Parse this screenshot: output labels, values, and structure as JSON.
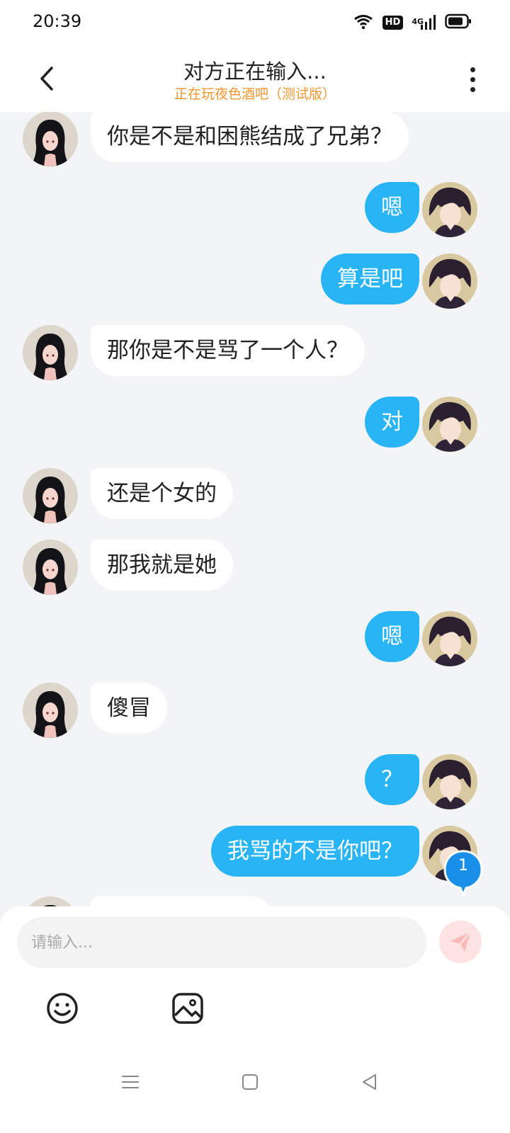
{
  "status_bar": {
    "time": "20:39",
    "hd_badge": "HD",
    "network": "4G",
    "icons": [
      "wifi-icon",
      "signal-icon",
      "battery-icon"
    ]
  },
  "header": {
    "title": "对方正在输入...",
    "subtitle": "正在玩夜色酒吧（测试版）",
    "back_icon": "chevron-left-icon",
    "more_icon": "more-vertical-icon"
  },
  "messages": [
    {
      "side": "left",
      "text": "你是不是和困熊结成了兄弟？"
    },
    {
      "side": "right",
      "text": "嗯"
    },
    {
      "side": "right",
      "text": "算是吧"
    },
    {
      "side": "left",
      "text": "那你是不是骂了一个人？"
    },
    {
      "side": "right",
      "text": "对"
    },
    {
      "side": "left",
      "text": "还是个女的"
    },
    {
      "side": "left",
      "text": "那我就是她"
    },
    {
      "side": "right",
      "text": "嗯"
    },
    {
      "side": "left",
      "text": "傻冒"
    },
    {
      "side": "right",
      "text": "？"
    },
    {
      "side": "right",
      "text": "我骂的不是你吧？"
    }
  ],
  "unread_badge": {
    "count": "1"
  },
  "composer": {
    "placeholder": "请输入...",
    "send_icon": "send-icon",
    "emoji_icon": "emoji-icon",
    "image_icon": "image-icon"
  },
  "colors": {
    "accent": "#29b4f6",
    "subtitle": "#f0952e",
    "background": "#f3f4f6",
    "send_button": "#fde2e2"
  }
}
